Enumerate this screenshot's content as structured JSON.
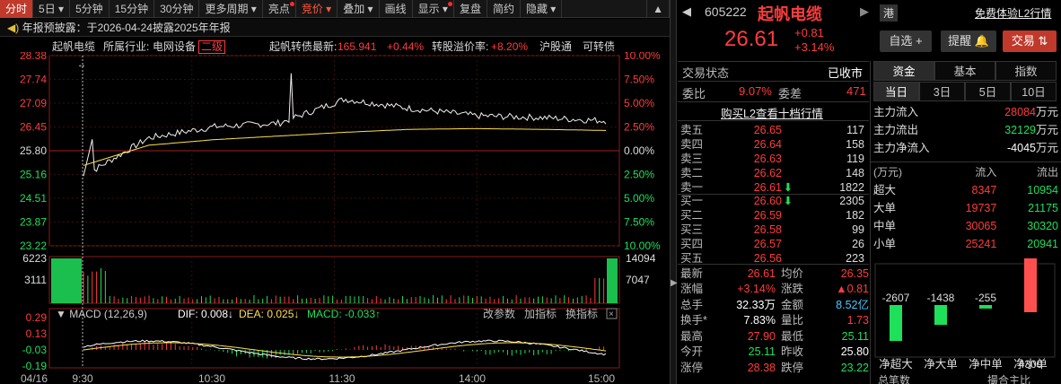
{
  "toolbar": {
    "items": [
      {
        "label": "分时",
        "active": true
      },
      {
        "label": "5日 ▾"
      },
      {
        "label": "5分钟"
      },
      {
        "label": "15分钟"
      },
      {
        "label": "30分钟"
      },
      {
        "label": "更多周期 ▾"
      },
      {
        "label": "亮点",
        "dot": true
      },
      {
        "label": "竞价 ▾",
        "hl": true
      },
      {
        "label": "叠加 ▾"
      },
      {
        "label": "画线"
      },
      {
        "label": "显示 ▾",
        "dot": true
      },
      {
        "label": "复盘"
      },
      {
        "label": "简约"
      },
      {
        "label": "隐藏 ▾"
      }
    ]
  },
  "notice": {
    "text": "年报预披露：于2026-04-24披露2025年年报"
  },
  "info": {
    "name": "起帆电缆",
    "industry_label": "所属行业:",
    "industry": "电网设备",
    "level": "二级",
    "bond_label": "起帆转债最新:",
    "bond_price": "165.941",
    "bond_pct": "+0.44%",
    "premium_label": "转股溢价率:",
    "premium": "+8.20%",
    "tag1": "沪股通",
    "tag2": "可转债"
  },
  "chart": {
    "price_axis": [
      "28.38",
      "27.74",
      "27.09",
      "26.45",
      "25.80",
      "25.16",
      "24.51",
      "23.87",
      "23.22"
    ],
    "pct_axis": [
      "10.00%",
      "7.50%",
      "5.00%",
      "2.50%",
      "0.00%",
      "2.50%",
      "5.00%",
      "7.50%",
      "10.00%"
    ],
    "vol_axis_left": [
      "6223",
      "3111"
    ],
    "vol_axis_right": [
      "14094",
      "7047"
    ],
    "macd_label": "MACD (12,26,9)",
    "dif": "DIF: 0.008↓",
    "dea": "DEA: 0.025↓",
    "macd": "MACD: -0.033↑",
    "macd_buttons": [
      "改参数",
      "加指标",
      "换指标"
    ],
    "macd_axis": [
      "0.29",
      "0.13",
      "-0.03",
      "-0.19"
    ],
    "time_axis": [
      "04/16",
      "9:30",
      "10:30",
      "11:30",
      "14:00",
      "15:00"
    ]
  },
  "chart_data": {
    "type": "line",
    "title": "",
    "ylim": [
      23.22,
      28.38
    ],
    "prev_close": 25.8,
    "x": [
      "9:30",
      "10:00",
      "10:30",
      "11:00",
      "11:30",
      "13:30",
      "14:00",
      "14:30",
      "15:00"
    ],
    "series": [
      {
        "values": [
          25.11,
          26.15,
          26.45,
          26.55,
          27.2,
          26.95,
          26.75,
          26.7,
          26.61
        ]
      },
      {
        "values": [
          25.4,
          25.95,
          26.1,
          26.2,
          26.3,
          26.38,
          26.4,
          26.38,
          26.35
        ]
      }
    ]
  },
  "stock": {
    "code": "605222",
    "name": "起帆电缆",
    "hk": "港",
    "free_trial": "免费体验L2行情",
    "price": "26.61",
    "change": "+0.81",
    "pct": "+3.14%",
    "fav_label": "自选 +",
    "alert_label": "提醒",
    "trade_label": "交易"
  },
  "status": {
    "label": "交易状态",
    "value": "已收市",
    "ratio_label": "委比",
    "ratio": "9.07%",
    "diff_label": "委差",
    "diff": "471",
    "l2": "购买L2查看十档行情"
  },
  "asks": [
    {
      "label": "卖五",
      "price": "26.65",
      "vol": "117"
    },
    {
      "label": "卖四",
      "price": "26.64",
      "vol": "158"
    },
    {
      "label": "卖三",
      "price": "26.63",
      "vol": "119"
    },
    {
      "label": "卖二",
      "price": "26.62",
      "vol": "148"
    },
    {
      "label": "卖一",
      "price": "26.61",
      "vol": "1822",
      "arrow": "⬇"
    }
  ],
  "bids": [
    {
      "label": "买一",
      "price": "26.60",
      "vol": "2305",
      "arrow": "⬇"
    },
    {
      "label": "买二",
      "price": "26.59",
      "vol": "182"
    },
    {
      "label": "买三",
      "price": "26.58",
      "vol": "99"
    },
    {
      "label": "买四",
      "price": "26.57",
      "vol": "26"
    },
    {
      "label": "买五",
      "price": "26.56",
      "vol": "223"
    }
  ],
  "quotes": [
    {
      "l1": "最新",
      "v1": "26.61",
      "c1": "red",
      "l2": "均价",
      "v2": "26.35",
      "c2": "red"
    },
    {
      "l1": "涨幅",
      "v1": "+3.14%",
      "c1": "red",
      "l2": "涨跌",
      "v2": "▲0.81",
      "c2": "red"
    },
    {
      "l1": "总手",
      "v1": "32.33万",
      "c1": "white",
      "l2": "金额",
      "v2": "8.52亿",
      "c2": "cyan"
    },
    {
      "l1": "换手*",
      "v1": "7.83%",
      "c1": "white",
      "l2": "量比",
      "v2": "1.73",
      "c2": "red"
    },
    {
      "l1": "最高",
      "v1": "27.90",
      "c1": "red",
      "l2": "最低",
      "v2": "25.11",
      "c2": "green"
    },
    {
      "l1": "今开",
      "v1": "25.11",
      "c1": "green",
      "l2": "昨收",
      "v2": "25.80",
      "c2": "white"
    },
    {
      "l1": "涨停",
      "v1": "28.38",
      "c1": "red",
      "l2": "跌停",
      "v2": "23.22",
      "c2": "green"
    }
  ],
  "fund": {
    "tabs": [
      "资金",
      "基本",
      "指数"
    ],
    "periods": [
      "当日",
      "3日",
      "5日",
      "10日"
    ],
    "rows": [
      {
        "label": "主力流入",
        "value": "28084",
        "unit": "万元",
        "color": "red"
      },
      {
        "label": "主力流出",
        "value": "32129",
        "unit": "万元",
        "color": "green"
      },
      {
        "label": "主力净流入",
        "value": "-4045",
        "unit": "万元",
        "color": "white"
      }
    ],
    "table_head": [
      "(万元)",
      "流入",
      "流出"
    ],
    "table": [
      {
        "label": "超大",
        "in": "8347",
        "out": "10954"
      },
      {
        "label": "大单",
        "in": "19737",
        "out": "21175"
      },
      {
        "label": "中单",
        "in": "30065",
        "out": "30320"
      },
      {
        "label": "小单",
        "in": "25241",
        "out": "20941"
      }
    ],
    "bars": [
      {
        "value": -2607,
        "label": "-2607"
      },
      {
        "value": -1438,
        "label": "-1438"
      },
      {
        "value": -255,
        "label": "-255"
      },
      {
        "value": 4300,
        "label": "4300"
      }
    ],
    "bar_names": [
      "净超大",
      "净大单",
      "净中单",
      "净小单"
    ],
    "bottom": [
      "总笔数",
      "撮合主比"
    ]
  }
}
